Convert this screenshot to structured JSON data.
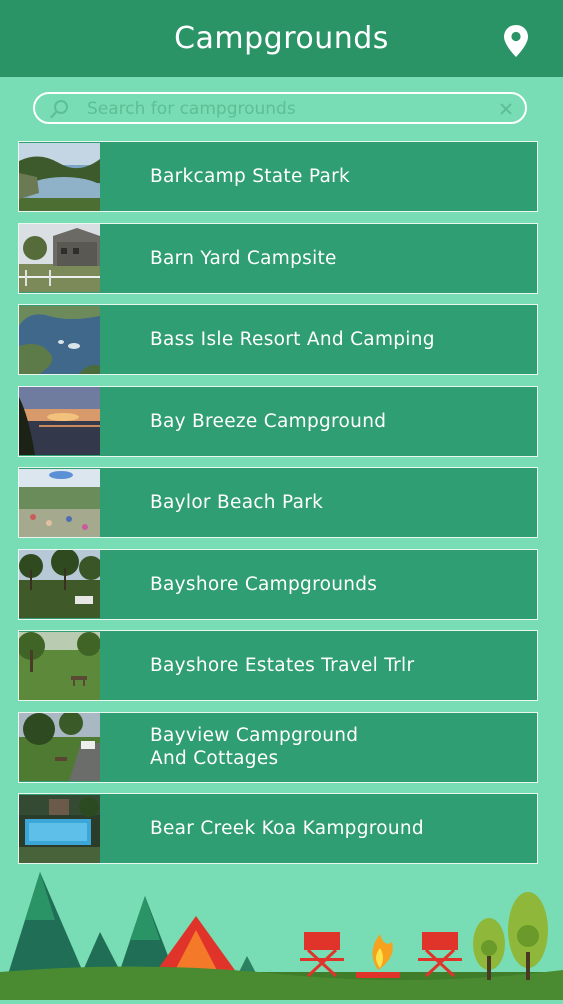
{
  "header": {
    "title": "Campgrounds",
    "location_icon": "map-pin-icon"
  },
  "search": {
    "placeholder": "Search for campgrounds",
    "value": "",
    "search_icon": "magnifier-icon",
    "clear_icon": "close-icon"
  },
  "campgrounds": [
    {
      "name": "Barkcamp State Park",
      "thumb": "lake-icon"
    },
    {
      "name": "Barn Yard Campsite",
      "thumb": "barn-icon"
    },
    {
      "name": "Bass Isle Resort And Camping",
      "thumb": "aerial-lake-icon"
    },
    {
      "name": "Bay Breeze Campground",
      "thumb": "sunset-icon"
    },
    {
      "name": "Baylor Beach Park",
      "thumb": "beach-icon"
    },
    {
      "name": "Bayshore Campgrounds",
      "thumb": "trees-icon"
    },
    {
      "name": "Bayshore Estates Travel Trlr",
      "thumb": "park-icon"
    },
    {
      "name": "Bayview Campground\nAnd Cottages",
      "thumb": "road-icon"
    },
    {
      "name": "Bear Creek Koa Kampground",
      "thumb": "pool-icon"
    }
  ],
  "colors": {
    "header": "#2a9467",
    "background": "#78dcb4",
    "row": "#2f9e72",
    "text": "#ffffff"
  }
}
